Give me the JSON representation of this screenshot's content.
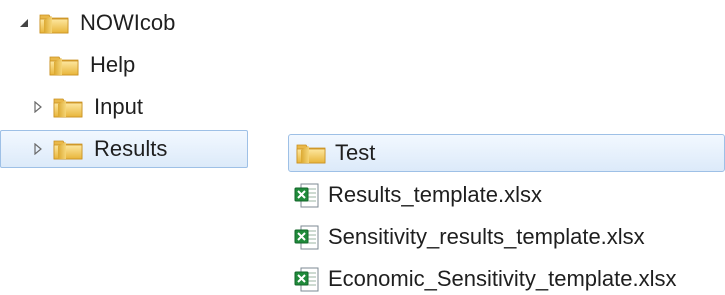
{
  "tree": {
    "root": {
      "label": "NOWIcob",
      "expanded": true
    },
    "children": [
      {
        "label": "Help",
        "has_children": false,
        "selected": false
      },
      {
        "label": "Input",
        "has_children": true,
        "selected": false
      },
      {
        "label": "Results",
        "has_children": true,
        "selected": true
      }
    ]
  },
  "files": [
    {
      "label": "Test",
      "type": "folder",
      "selected": true
    },
    {
      "label": "Results_template.xlsx",
      "type": "excel"
    },
    {
      "label": "Sensitivity_results_template.xlsx",
      "type": "excel"
    },
    {
      "label": "Economic_Sensitivity_template.xlsx",
      "type": "excel"
    }
  ],
  "colors": {
    "folder_yellow": "#f3c94b",
    "selection_border": "#9ec0e6",
    "excel_green": "#1f8a3a"
  },
  "icons": {
    "expanded_arrow": "triangle-down-right",
    "collapsed_arrow": "triangle-right-outline",
    "folder": "folder-icon",
    "excel": "excel-file-icon"
  }
}
